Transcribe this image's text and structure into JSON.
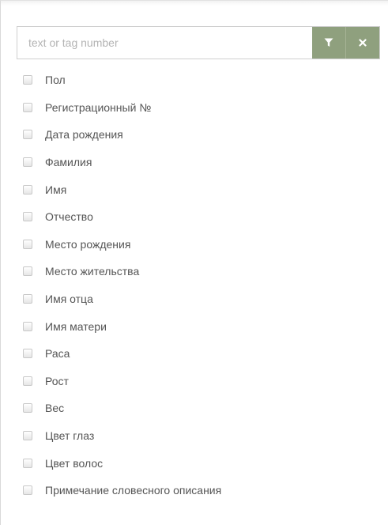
{
  "search": {
    "placeholder": "text or tag number",
    "value": ""
  },
  "buttons": {
    "filter_icon": "filter-icon",
    "clear_icon": "close-icon"
  },
  "colors": {
    "button_bg": "#8fa07e",
    "text": "#555555"
  },
  "items": [
    {
      "label": "Пол",
      "checked": false
    },
    {
      "label": "Регистрационный №",
      "checked": false
    },
    {
      "label": "Дата рождения",
      "checked": false
    },
    {
      "label": "Фамилия",
      "checked": false
    },
    {
      "label": "Имя",
      "checked": false
    },
    {
      "label": "Отчество",
      "checked": false
    },
    {
      "label": "Место рождения",
      "checked": false
    },
    {
      "label": "Место жительства",
      "checked": false
    },
    {
      "label": "Имя отца",
      "checked": false
    },
    {
      "label": "Имя матери",
      "checked": false
    },
    {
      "label": "Раса",
      "checked": false
    },
    {
      "label": "Рост",
      "checked": false
    },
    {
      "label": "Вес",
      "checked": false
    },
    {
      "label": "Цвет глаз",
      "checked": false
    },
    {
      "label": "Цвет волос",
      "checked": false
    },
    {
      "label": "Примечание словесного описания",
      "checked": false
    }
  ]
}
